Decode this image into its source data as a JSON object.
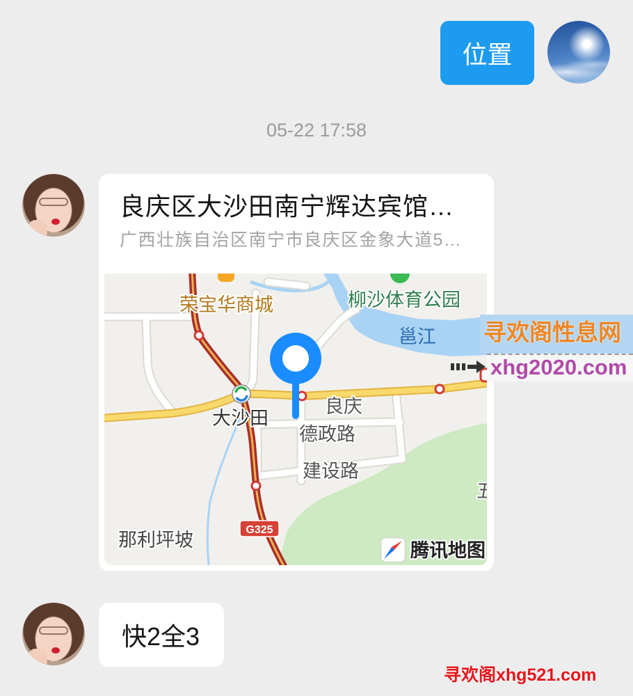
{
  "screen": {
    "background": "#ededed"
  },
  "outgoing": {
    "text": "位置",
    "bubble_color": "#1d9bf0",
    "avatar": "sky-sun-avatar"
  },
  "timestamp": "05-22 17:58",
  "location_card": {
    "title": "良庆区大沙田南宁辉达宾馆…",
    "address": "广西壮族自治区南宁市良庆区金象大道5…",
    "sender_avatar": "girl-photo-avatar",
    "map": {
      "provider": "腾讯地图",
      "labels": {
        "mall": "荣宝华商城",
        "park": "柳沙体育公园",
        "river": "邕江",
        "station": "大沙田",
        "district": "良庆",
        "road_1": "德政路",
        "road_2": "建设路",
        "village": "那利坪坡",
        "highway": "G325",
        "edge": "五"
      },
      "colors": {
        "pin": "#1a8cff",
        "river": "#a9d3f5",
        "greenery": "#cdeac3",
        "main_road": "#f9d96b",
        "highway": "#a8302a",
        "land": "#f1f0ec"
      },
      "icons": [
        "location-pin-icon",
        "mall-icon",
        "park-icon",
        "station-icon",
        "road-marker-icon",
        "compass-icon"
      ]
    }
  },
  "incoming": {
    "text": "快2全3",
    "avatar": "girl-photo-avatar"
  },
  "watermarks": {
    "site_name": "寻欢阁性息网",
    "site_url": "xhg2020.com",
    "footer": "寻欢阁xhg521.com",
    "colors": {
      "site_name": "#ef8622",
      "site_url": "#b04aa8",
      "footer": "#e5151b"
    }
  }
}
